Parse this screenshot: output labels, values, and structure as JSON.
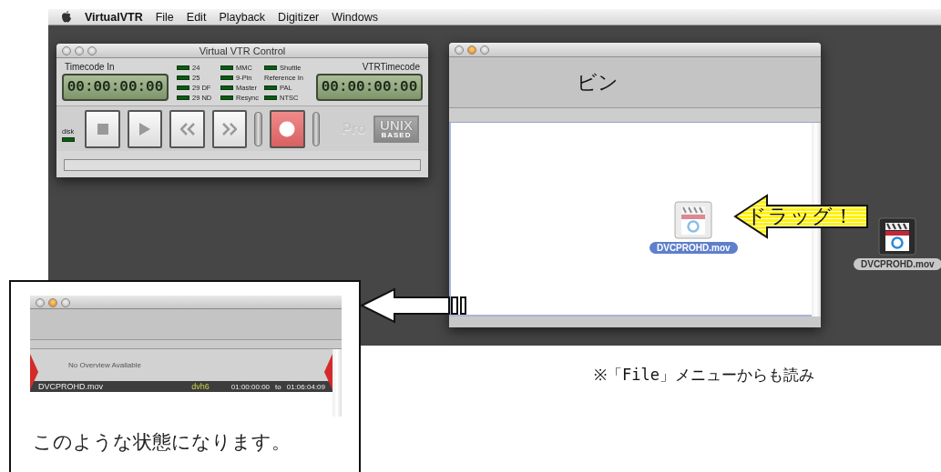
{
  "menu_bar": {
    "app": "VirtualVTR",
    "items": [
      "File",
      "Edit",
      "Playback",
      "Digitizer",
      "Windows"
    ]
  },
  "vtr_window": {
    "title": "Virtual VTR Control",
    "traffic_lights": [
      {
        "lit": false
      },
      {
        "lit": false
      },
      {
        "lit": false
      }
    ],
    "timecode_in_label": "Timecode In",
    "timecode_in": "00:00:00:00",
    "vtr_timecode_label": "VTRTimecode",
    "vtr_timecode": "00:00:00:00",
    "indicators": [
      {
        "label": "24",
        "led": true
      },
      {
        "label": "25",
        "led": true
      },
      {
        "label": "29 DF",
        "led": true
      },
      {
        "label": "29 ND",
        "led": true
      },
      {
        "label": "MMC",
        "led": true
      },
      {
        "label": "9-Pin",
        "led": true
      },
      {
        "label": "Master",
        "led": true
      },
      {
        "label": "Resync",
        "led": true
      },
      {
        "label": "Shuttle",
        "led": true
      },
      {
        "label": "Reference In",
        "led": false
      },
      {
        "label": "PAL",
        "led": true
      },
      {
        "label": "NTSC",
        "led": true
      }
    ],
    "disk_label": "disk",
    "transport": [
      {
        "kind": "stop"
      },
      {
        "kind": "play"
      },
      {
        "kind": "rewind"
      },
      {
        "kind": "forward"
      },
      {
        "kind": "record"
      }
    ],
    "pro_label": "Pro",
    "logo": [
      "UNIX",
      "BASED"
    ]
  },
  "bin_window": {
    "title": "ビン",
    "traffic_lights": [
      {
        "lit": false
      },
      {
        "lit": true
      },
      {
        "lit": false
      }
    ],
    "file": {
      "name": "DVCPROHD.mov",
      "selected": true
    }
  },
  "desktop_file": {
    "name": "DVCPROHD.mov",
    "selected": false
  },
  "drag_callout": "ドラッグ！",
  "result_callout": {
    "traffic_lights": [
      {
        "lit": false
      },
      {
        "lit": true
      },
      {
        "lit": false
      }
    ],
    "overview": "No Overview Available",
    "clip": "DVCPROHD.mov",
    "codec": "dvh6",
    "start": "01:00:00:00",
    "to": "to",
    "end": "01:06:04:09",
    "caption": "このような状態になります。"
  },
  "note": "※「File」メニューからも読み"
}
